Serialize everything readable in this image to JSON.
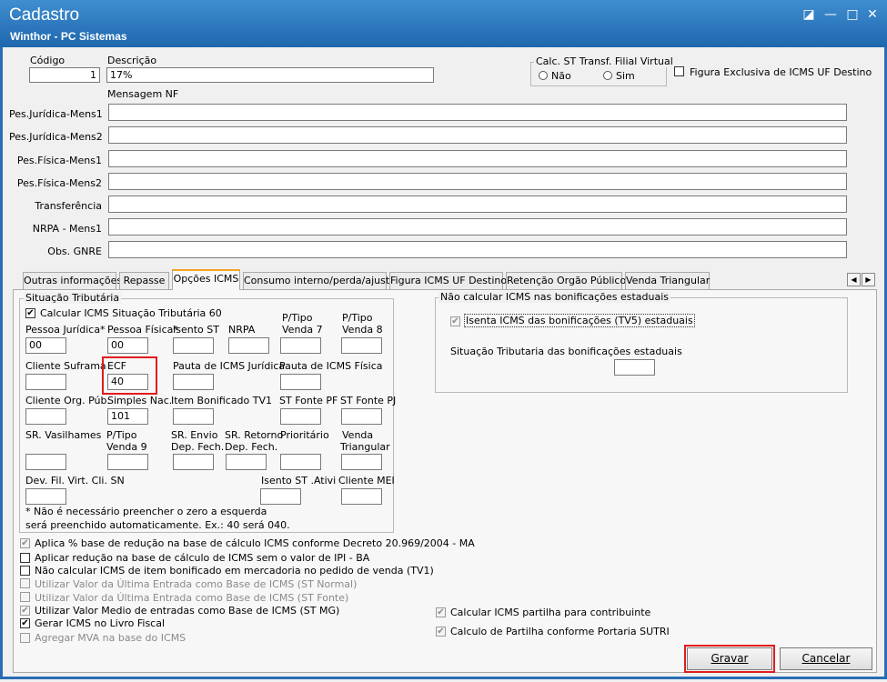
{
  "window": {
    "title": "Cadastro",
    "subtitle": "Winthor - PC Sistemas"
  },
  "header": {
    "codigo_label": "Código",
    "codigo_value": "1",
    "descricao_label": "Descrição",
    "descricao_value": "17%",
    "calc_st_label": "Calc. ST Transf. Filial Virtual",
    "radio_nao": "Não",
    "radio_sim": "Sim",
    "figura_exclusiva_label": "Figura Exclusiva de ICMS UF Destino",
    "mensagem_nf_label": "Mensagem NF"
  },
  "messages": [
    {
      "label": "Pes.Jurídica-Mens1",
      "value": ""
    },
    {
      "label": "Pes.Jurídica-Mens2",
      "value": ""
    },
    {
      "label": "Pes.Física-Mens1",
      "value": ""
    },
    {
      "label": "Pes.Física-Mens2",
      "value": ""
    },
    {
      "label": "Transferência",
      "value": ""
    },
    {
      "label": "NRPA - Mens1",
      "value": ""
    },
    {
      "label": "Obs. GNRE",
      "value": ""
    }
  ],
  "tabs": [
    "Outras informações",
    "Repasse",
    "Opções ICMS",
    "Consumo interno/perda/ajuste",
    "Figura ICMS UF Destino",
    "Retenção Orgão Público",
    "Venda Triangular"
  ],
  "situacao": {
    "group_label": "Situação Tributária",
    "calc_60_label": "Calcular ICMS Situação Tributária 60",
    "pessoa_juridica": "Pessoa Jurídica*",
    "pessoa_juridica_value": "00",
    "pessoa_fisica": "Pessoa Física*",
    "pessoa_fisica_value": "00",
    "isento_st": "Isento ST",
    "nrpa": "NRPA",
    "p_tipo_venda7_a": "P/Tipo",
    "p_tipo_venda7_b": "Venda 7",
    "p_tipo_venda8_a": "P/Tipo",
    "p_tipo_venda8_b": "Venda 8",
    "cliente_suframa": "Cliente Suframa",
    "ecf": "ECF",
    "ecf_value": "40",
    "pauta_juridica": "Pauta de ICMS Jurídica",
    "pauta_fisica": "Pauta de ICMS Física",
    "cliente_org_pub": "Cliente Org. Púb.",
    "simples_nac": "Simples Nac.",
    "simples_nac_value": "101",
    "item_bonificado": "Item Bonificado TV1",
    "st_fonte_pf": "ST Fonte PF",
    "st_fonte_pj": "ST Fonte PJ",
    "sr_vasilhames": "SR. Vasilhames",
    "p_tipo_venda9_a": "P/Tipo",
    "p_tipo_venda9_b": "Venda 9",
    "sr_envio_a": "SR. Envio",
    "sr_envio_b": "Dep. Fech.",
    "sr_retorno_a": "SR. Retorno",
    "sr_retorno_b": "Dep. Fech.",
    "prioritario": "Prioritário",
    "venda_triangular_a": "Venda",
    "venda_triangular_b": "Triangular",
    "dev_fil_virt": "Dev. Fil. Virt. Cli. SN",
    "isento_st_ativi": "Isento ST .Ativi",
    "cliente_mei": "Cliente MEI",
    "note1": "* Não é necessário preencher o zero a esquerda",
    "note2": "será preenchido automaticamente.  Ex.: 40 será 040."
  },
  "bonificacoes": {
    "group_label": "Não calcular ICMS nas bonificações estaduais",
    "isenta_label": "Isenta ICMS das bonificações (TV5) estaduais",
    "situacao_label": "Situação Tributaria das  bonificações estaduais"
  },
  "options": [
    {
      "label": "Aplica % base de redução na base de cálculo ICMS conforme Decreto 20.969/2004 - MA",
      "checked": true,
      "disabled": true
    },
    {
      "label": "Aplicar redução na base de cálculo de ICMS sem o valor de IPI - BA",
      "checked": false,
      "disabled": false
    },
    {
      "label": "Não calcular ICMS de item bonificado em mercadoria no pedido de venda (TV1)",
      "checked": false,
      "disabled": false
    },
    {
      "label": "Utilizar Valor da Última Entrada como Base de ICMS (ST Normal)",
      "checked": false,
      "disabled": true
    },
    {
      "label": "Utilizar Valor da Última Entrada como Base de ICMS (ST Fonte)",
      "checked": false,
      "disabled": true
    },
    {
      "label": "Utilizar Valor Medio de entradas como Base de ICMS (ST MG)",
      "checked": true,
      "disabled": true
    },
    {
      "label": "Gerar ICMS no Livro Fiscal",
      "checked": true,
      "disabled": false
    },
    {
      "label": "Agregar MVA na base do ICMS",
      "checked": false,
      "disabled": true
    }
  ],
  "partilha": {
    "contribuinte_label": "Calcular ICMS partilha para contribuinte",
    "sutri_label": "Calculo de Partilha conforme Portaria SUTRI"
  },
  "buttons": {
    "gravar": "Gravar",
    "cancelar": "Cancelar"
  },
  "colors": {
    "titlebar": "#2a6db5",
    "highlight": "#e21b1b",
    "tab_active": "#f5a623"
  }
}
